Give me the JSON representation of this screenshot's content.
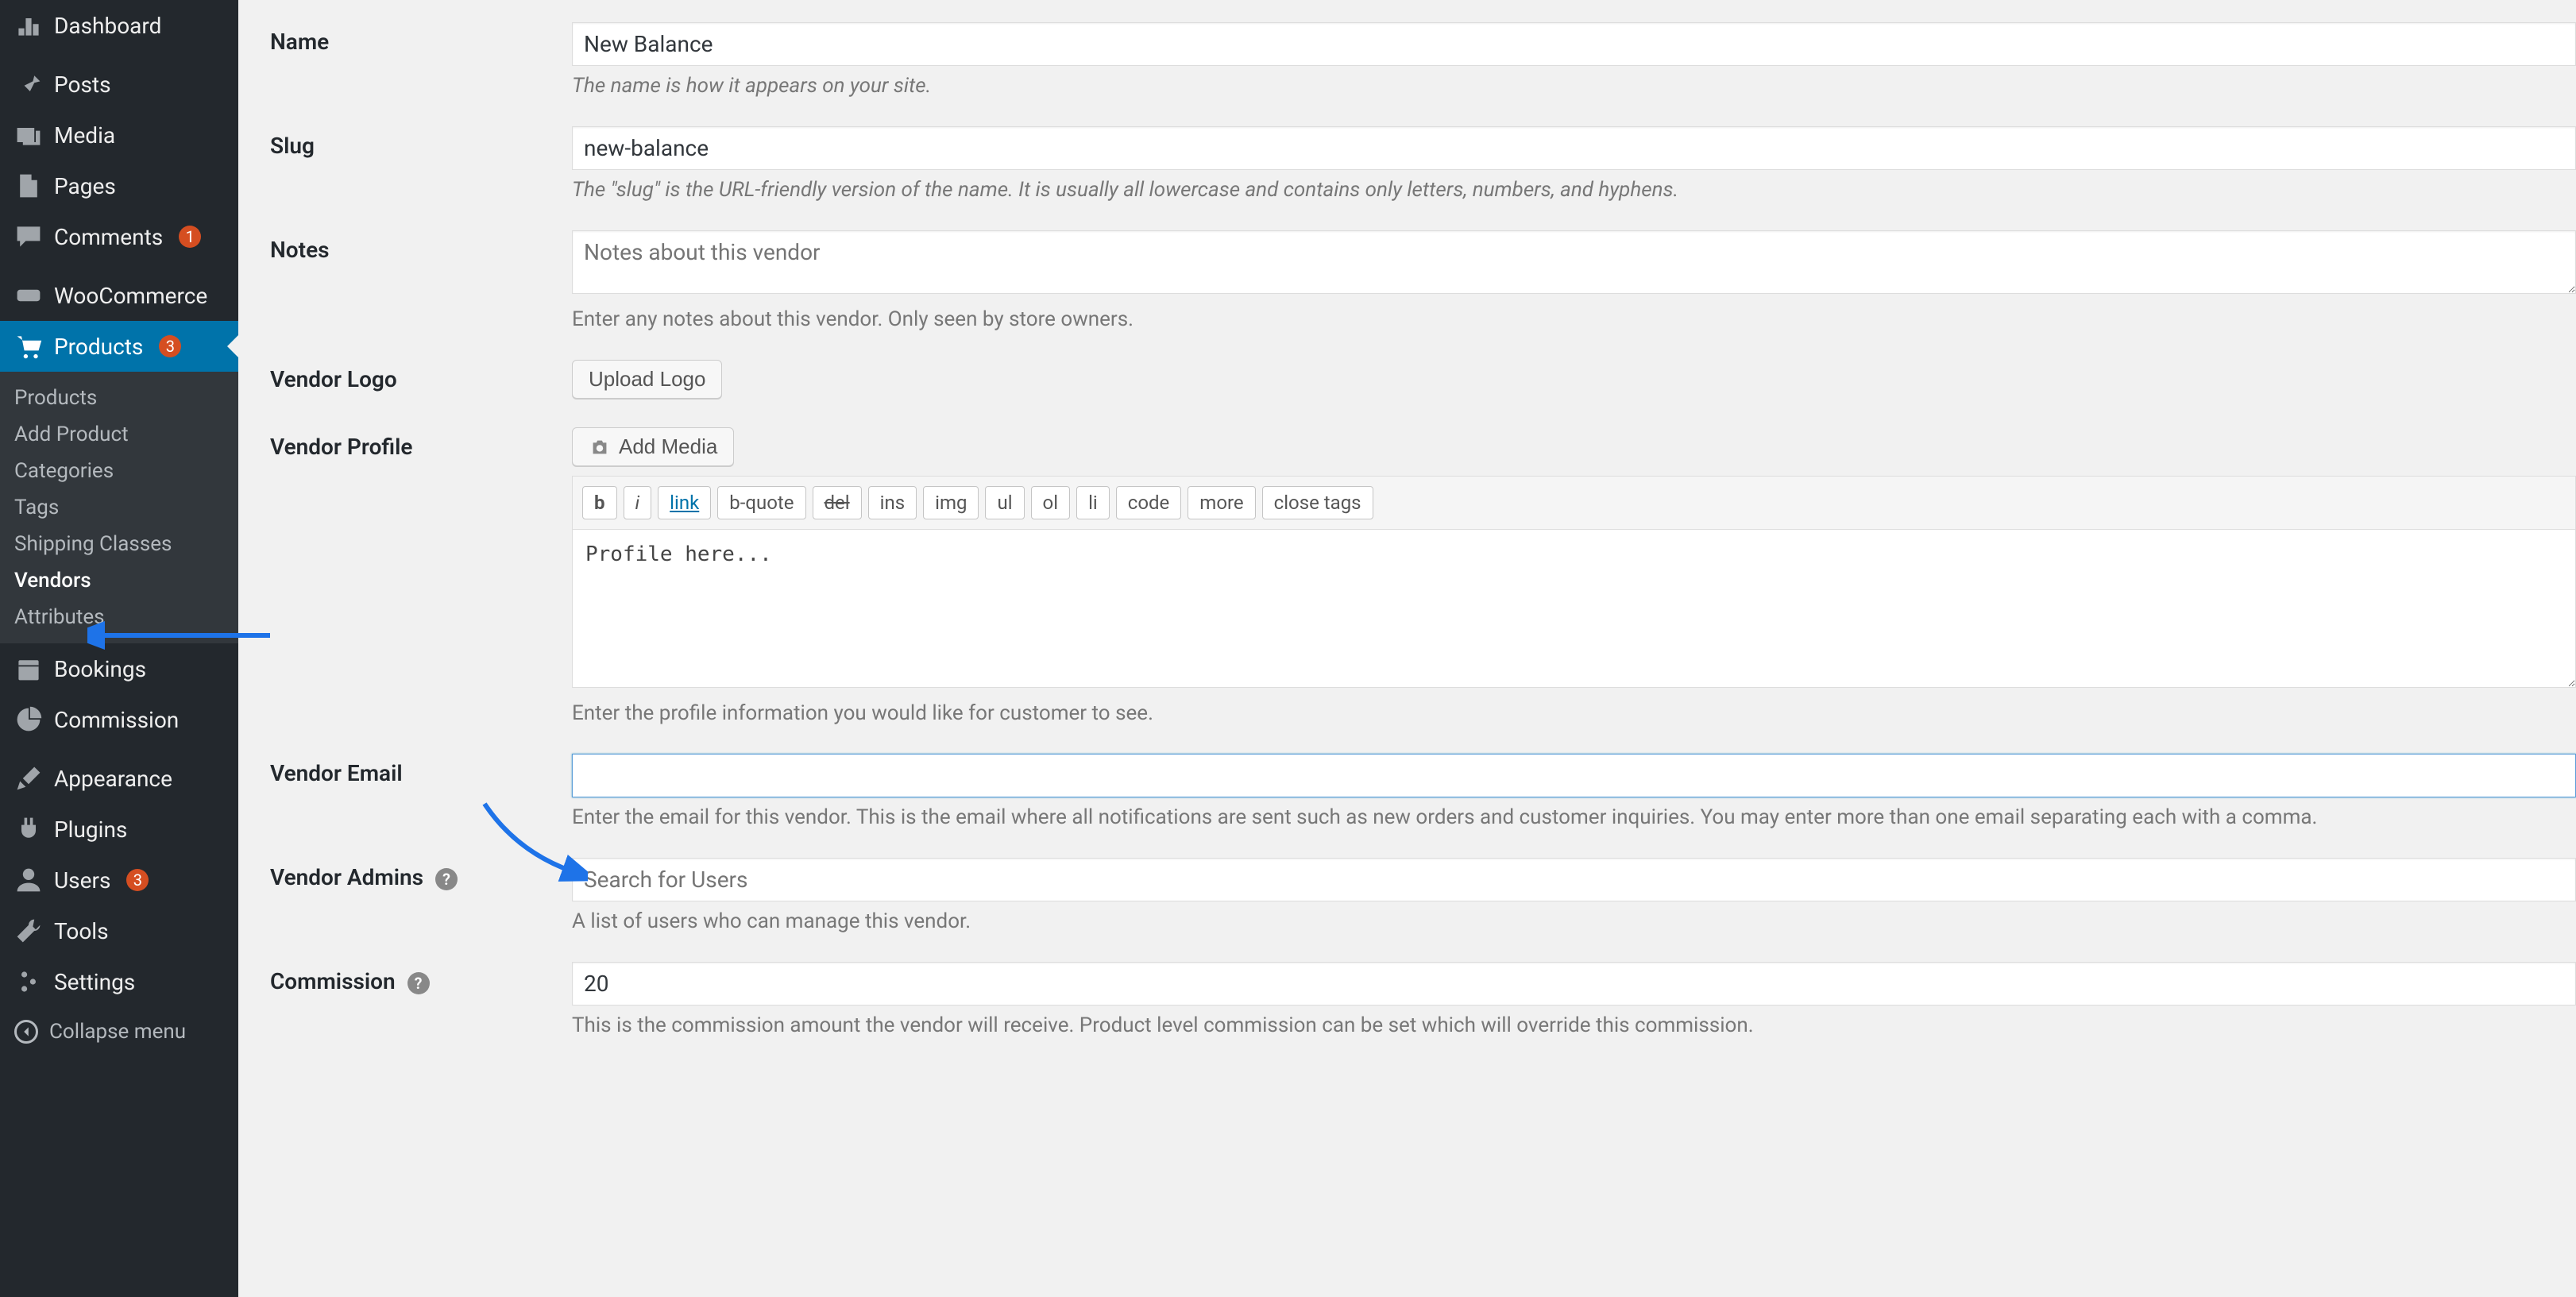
{
  "sidebar": {
    "dashboard": "Dashboard",
    "posts": "Posts",
    "media": "Media",
    "pages": "Pages",
    "comments": "Comments",
    "comments_badge": "1",
    "woocommerce": "WooCommerce",
    "products": "Products",
    "products_badge": "3",
    "submenu": {
      "products": "Products",
      "add_product": "Add Product",
      "categories": "Categories",
      "tags": "Tags",
      "shipping_classes": "Shipping Classes",
      "vendors": "Vendors",
      "attributes": "Attributes"
    },
    "bookings": "Bookings",
    "commission": "Commission",
    "appearance": "Appearance",
    "plugins": "Plugins",
    "users": "Users",
    "users_badge": "3",
    "tools": "Tools",
    "settings": "Settings",
    "collapse": "Collapse menu"
  },
  "form": {
    "name": {
      "label": "Name",
      "value": "New Balance",
      "desc": "The name is how it appears on your site."
    },
    "slug": {
      "label": "Slug",
      "value": "new-balance",
      "desc": "The \"slug\" is the URL-friendly version of the name. It is usually all lowercase and contains only letters, numbers, and hyphens."
    },
    "notes": {
      "label": "Notes",
      "placeholder": "Notes about this vendor",
      "desc": "Enter any notes about this vendor. Only seen by store owners."
    },
    "logo": {
      "label": "Vendor Logo",
      "button": "Upload Logo"
    },
    "profile": {
      "label": "Vendor Profile",
      "add_media": "Add Media",
      "value": "Profile here...",
      "desc": "Enter the profile information you would like for customer to see."
    },
    "email": {
      "label": "Vendor Email",
      "value": "",
      "desc": "Enter the email for this vendor. This is the email where all notifications are sent such as new orders and customer inquiries. You may enter more than one email separating each with a comma."
    },
    "admins": {
      "label": "Vendor Admins",
      "placeholder": "Search for Users",
      "desc": "A list of users who can manage this vendor."
    },
    "commission": {
      "label": "Commission",
      "value": "20",
      "desc": "This is the commission amount the vendor will receive. Product level commission can be set which will override this commission."
    }
  },
  "quicktags": {
    "b": "b",
    "i": "i",
    "link": "link",
    "bquote": "b-quote",
    "del": "del",
    "ins": "ins",
    "img": "img",
    "ul": "ul",
    "ol": "ol",
    "li": "li",
    "code": "code",
    "more": "more",
    "close": "close tags"
  }
}
